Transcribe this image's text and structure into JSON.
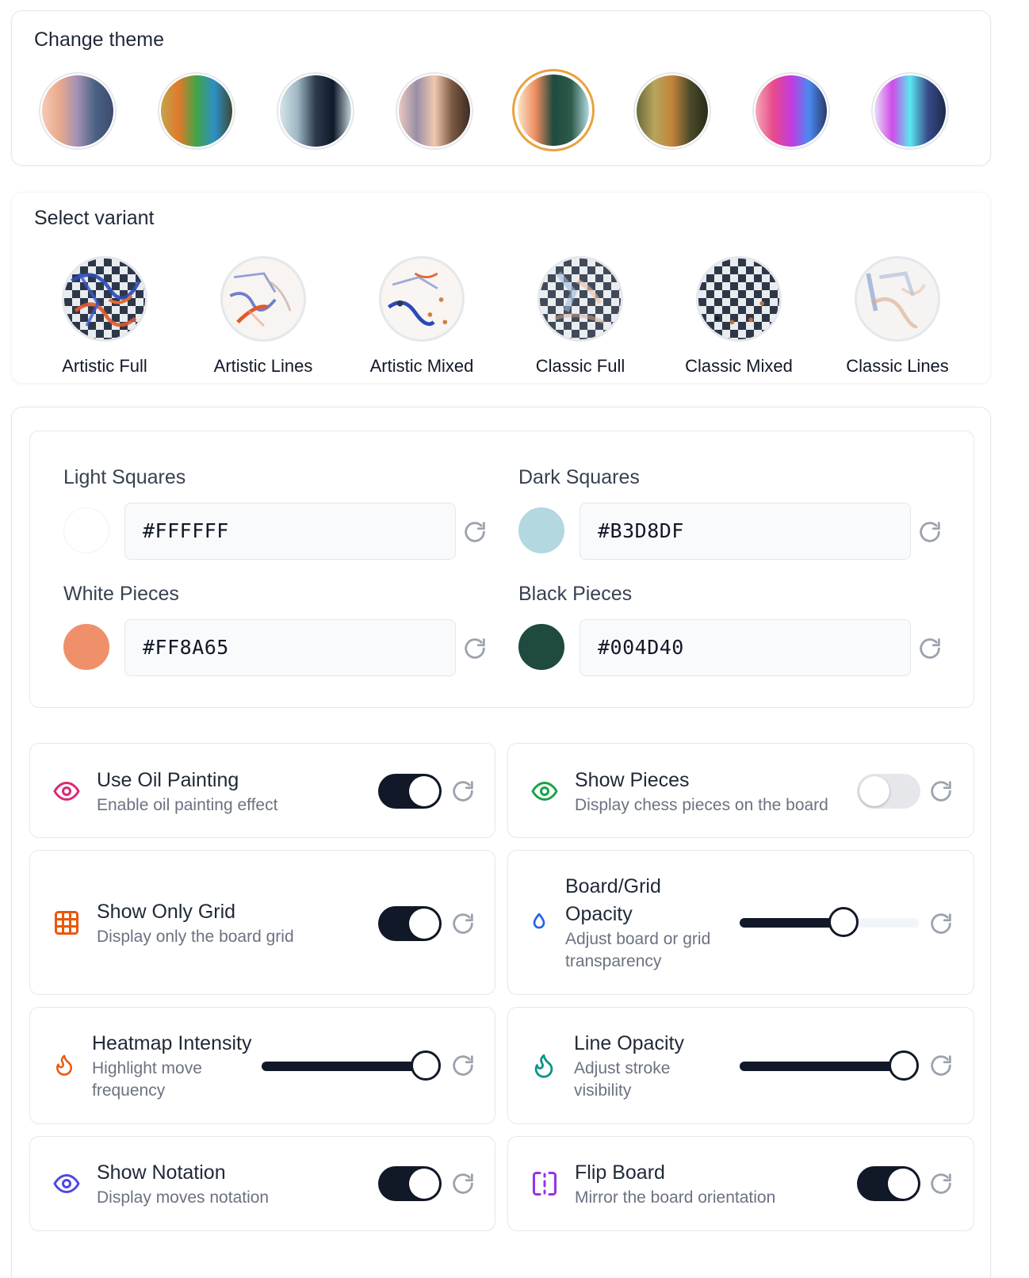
{
  "theme": {
    "title": "Change theme",
    "swatches": [
      {
        "name": "theme-1",
        "colors": [
          "#f6c9b5",
          "#e8a98c",
          "#a18fb3",
          "#4a6183",
          "#3d4a6e"
        ]
      },
      {
        "name": "theme-2",
        "colors": [
          "#c3a44c",
          "#e07a2a",
          "#3fa44a",
          "#2f8fc4",
          "#3a4a35"
        ]
      },
      {
        "name": "theme-3",
        "colors": [
          "#d6e4ea",
          "#9eb6c2",
          "#2c3a4c",
          "#0f1a2a",
          "#c5d3da"
        ]
      },
      {
        "name": "theme-4",
        "colors": [
          "#e9c9c0",
          "#9a8ea6",
          "#f0c8b0",
          "#7a5840",
          "#3d2b22"
        ]
      },
      {
        "name": "theme-5",
        "colors": [
          "#f8e7c8",
          "#ef8c5f",
          "#1f4a3f",
          "#2d5a4a",
          "#b3d8df"
        ],
        "selected": true
      },
      {
        "name": "theme-6",
        "colors": [
          "#6a6a3a",
          "#b8a45c",
          "#c2843a",
          "#4a4a2a",
          "#2a2a1a"
        ]
      },
      {
        "name": "theme-7",
        "colors": [
          "#f5a8b8",
          "#e84a8a",
          "#c43ae0",
          "#4a8af0",
          "#2a3a6a"
        ]
      },
      {
        "name": "theme-8",
        "colors": [
          "#e8e0f8",
          "#d04ae8",
          "#5ae8f0",
          "#3a4a8a",
          "#1a2a4a"
        ]
      }
    ]
  },
  "variant": {
    "title": "Select variant",
    "items": [
      {
        "label": "Artistic Full"
      },
      {
        "label": "Artistic Lines"
      },
      {
        "label": "Artistic Mixed"
      },
      {
        "label": "Classic Full"
      },
      {
        "label": "Classic Mixed"
      },
      {
        "label": "Classic Lines"
      }
    ]
  },
  "colors": {
    "light_squares": {
      "label": "Light Squares",
      "value": "#FFFFFF",
      "swatch": "#FFFFFF"
    },
    "dark_squares": {
      "label": "Dark Squares",
      "value": "#B3D8DF",
      "swatch": "#B3D8DF"
    },
    "white_pieces": {
      "label": "White Pieces",
      "value": "#FF8A65",
      "swatch": "#F0906B"
    },
    "black_pieces": {
      "label": "Black Pieces",
      "value": "#004D40",
      "swatch": "#1E4A40"
    }
  },
  "settings": {
    "oil_painting": {
      "title": "Use Oil Painting",
      "desc": "Enable oil painting effect",
      "on": true,
      "icon": "eye-icon",
      "icon_color": "#db2777"
    },
    "show_pieces": {
      "title": "Show Pieces",
      "desc": "Display chess pieces on the board",
      "on": false,
      "icon": "eye-icon",
      "icon_color": "#16a34a"
    },
    "show_only_grid": {
      "title": "Show Only Grid",
      "desc": "Display only the board grid",
      "on": true,
      "icon": "grid-icon",
      "icon_color": "#ea580c"
    },
    "board_grid_opacity": {
      "title_line1": "Board/Grid",
      "title_line2": "Opacity",
      "desc_line1": "Adjust board or grid",
      "desc_line2": "transparency",
      "value": 0.58,
      "icon": "droplet-icon",
      "icon_color": "#2563eb"
    },
    "heatmap_intensity": {
      "title": "Heatmap Intensity",
      "desc_line1": "Highlight move",
      "desc_line2": "frequency",
      "value": 1.0,
      "icon": "flame-icon",
      "icon_color": "#ea580c"
    },
    "line_opacity": {
      "title": "Line Opacity",
      "desc_line1": "Adjust stroke",
      "desc_line2": "visibility",
      "value": 1.0,
      "icon": "flame-icon",
      "icon_color": "#0d9488"
    },
    "show_notation": {
      "title": "Show Notation",
      "desc": "Display moves notation",
      "on": true,
      "icon": "eye-icon",
      "icon_color": "#4f46e5"
    },
    "flip_board": {
      "title": "Flip Board",
      "desc": "Mirror the board orientation",
      "on": true,
      "icon": "flip-icon",
      "icon_color": "#9333ea"
    }
  }
}
